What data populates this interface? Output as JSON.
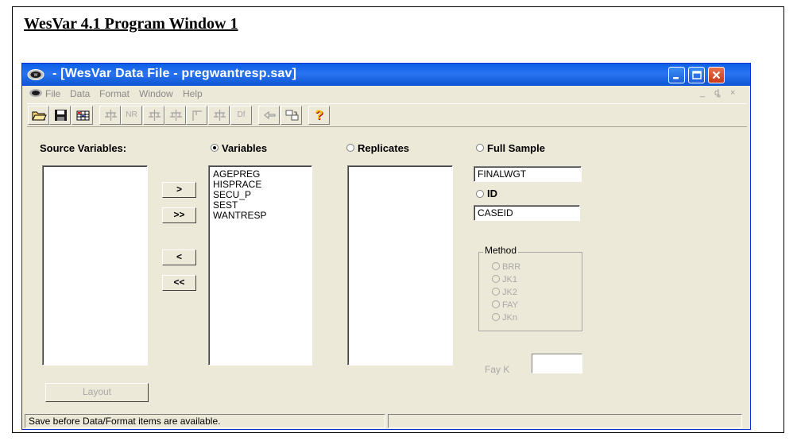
{
  "document": {
    "title": "WesVar 4.1 Program Window 1"
  },
  "window": {
    "title": "- [WesVar Data File - pregwantresp.sav]",
    "app_icon": "wesvar-logo-icon",
    "controls": [
      "minimize-icon",
      "maximize-icon",
      "close-icon"
    ]
  },
  "menu": {
    "items": [
      "File",
      "Data",
      "Format",
      "Window",
      "Help"
    ],
    "mdi_controls": [
      "_",
      "ȡ",
      "×"
    ]
  },
  "toolbar": {
    "buttons": [
      {
        "icon": "open-folder-icon",
        "label": ""
      },
      {
        "icon": "save-disk-icon",
        "label": ""
      },
      {
        "icon": "data-grid-icon",
        "label": ""
      },
      {
        "icon": "tree-icon",
        "label": ""
      },
      {
        "icon": "nr-icon",
        "label": "NR"
      },
      {
        "icon": "tree-icon",
        "label": ""
      },
      {
        "icon": "tree-icon",
        "label": ""
      },
      {
        "icon": "column-icon",
        "label": ""
      },
      {
        "icon": "tree-icon",
        "label": ""
      },
      {
        "icon": "df-icon",
        "label": "Df"
      },
      {
        "icon": "back-arrow-icon",
        "label": ""
      },
      {
        "icon": "copy-icon",
        "label": ""
      },
      {
        "icon": "help-question-icon",
        "label": "?"
      }
    ]
  },
  "source": {
    "label": "Source Variables:",
    "items": []
  },
  "variables": {
    "label": "Variables",
    "selected": true,
    "items": [
      "AGEPREG",
      "HISPRACE",
      "SECU_P",
      "SEST",
      "WANTRESP"
    ]
  },
  "replicates": {
    "label": "Replicates",
    "selected": false,
    "items": []
  },
  "full_sample": {
    "label": "Full Sample",
    "selected": false,
    "value": "FINALWGT"
  },
  "id": {
    "label": "ID",
    "selected": false,
    "value": "CASEID"
  },
  "move_buttons": [
    ">",
    ">>",
    "<",
    "<<"
  ],
  "method": {
    "title": "Method",
    "options": [
      "BRR",
      "JK1",
      "JK2",
      "FAY",
      "JKn"
    ]
  },
  "fay_k": {
    "label": "Fay K",
    "value": ""
  },
  "layout_button": "Layout",
  "status": {
    "message": "Save before Data/Format items are available.",
    "right": ""
  }
}
